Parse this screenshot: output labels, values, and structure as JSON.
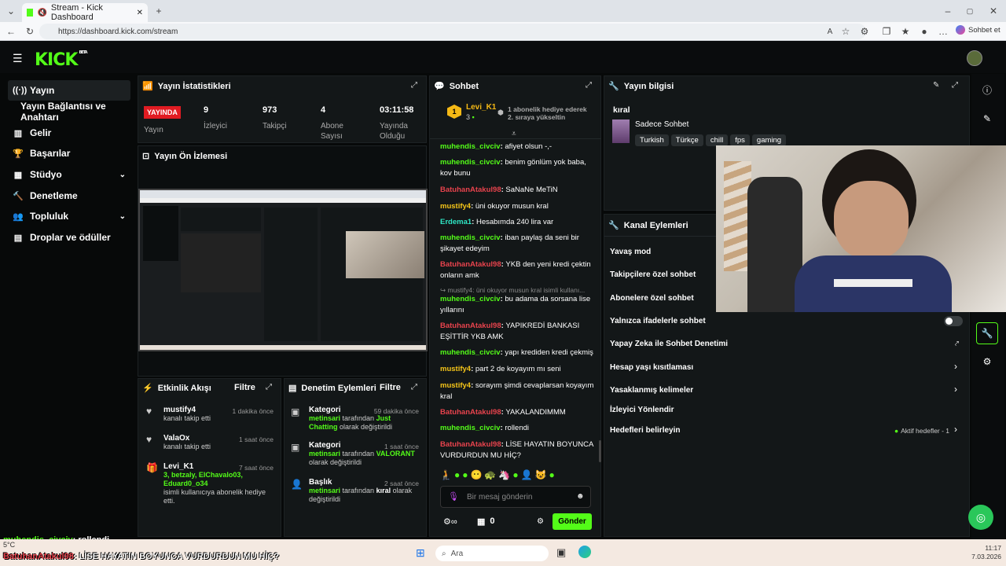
{
  "browser": {
    "tab_title": "Stream - Kick Dashboard",
    "url": "https://dashboard.kick.com/stream",
    "copilot_label": "Sohbet et"
  },
  "brand": {
    "name": "KICK",
    "beta": "BETA",
    "accent": "#53fc18"
  },
  "sidebar": {
    "items": [
      {
        "label": "Yayın",
        "icon": "broadcast-icon"
      },
      {
        "label": "Yayın Bağlantısı ve Anahtarı",
        "icon": ""
      },
      {
        "label": "Gelir",
        "icon": "revenue-icon"
      },
      {
        "label": "Başarılar",
        "icon": "trophy-icon"
      },
      {
        "label": "Stüdyo",
        "icon": "studio-icon"
      },
      {
        "label": "Denetleme",
        "icon": "moderation-icon"
      },
      {
        "label": "Topluluk",
        "icon": "community-icon"
      },
      {
        "label": "Droplar ve ödüller",
        "icon": "drops-icon"
      }
    ]
  },
  "stats": {
    "title": "Yayın İstatistikleri",
    "live_badge": "YAYINDA",
    "live_label": "Yayın",
    "items": [
      {
        "value": "9",
        "label": "İzleyici"
      },
      {
        "value": "973",
        "label": "Takipçi"
      },
      {
        "value": "4",
        "label": "Abone Sayısı"
      },
      {
        "value": "03:11:58",
        "label": "Yayında Olduğu"
      }
    ]
  },
  "preview": {
    "title": "Yayın Ön İzlemesi"
  },
  "activity": {
    "title": "Etkinlik Akışı",
    "filter": "Filtre",
    "items": [
      {
        "name": "mustify4",
        "desc": "kanalı takip etti",
        "time": "1 dakika önce"
      },
      {
        "name": "ValaOx",
        "desc": "kanalı takip etti",
        "time": "1 saat önce"
      },
      {
        "name": "Levi_K1",
        "desc": "isimli kullanıcıya abonelik hediye etti.",
        "time": "7 saat önce",
        "gift": "3, betzaly, ElChavalo03, Eduard0_o34"
      }
    ]
  },
  "mod_actions": {
    "title": "Denetim Eylemleri",
    "filter": "Filtre",
    "items": [
      {
        "title": "Kategori",
        "time": "59 dakika önce",
        "user": "metinsari",
        "mid": " tarafından ",
        "value": "Just Chatting",
        "tail": "olarak değiştirildi"
      },
      {
        "title": "Kategori",
        "time": "1 saat önce",
        "user": "metinsari",
        "mid": " tarafından ",
        "value": "VALORANT",
        "tail": "olarak değiştirildi"
      },
      {
        "title": "Başlık",
        "time": "2 saat önce",
        "user": "metinsari",
        "mid": " tarafından ",
        "value": "kıral",
        "tail": "olarak değiştirildi"
      }
    ]
  },
  "chat": {
    "title": "Sohbet",
    "pinned_user": "Levi_K1",
    "pinned_count": "3",
    "pinned_text1": "1 abonelik hediye ederek",
    "pinned_text2": "2. sıraya yükseltin",
    "messages": [
      {
        "user": "muhendis_civciv",
        "text": "afiyet olsun -,-",
        "color": "green"
      },
      {
        "user": "muhendis_civciv",
        "text": "benim gönlüm yok baba, kov bunu",
        "color": "green"
      },
      {
        "user": "BatuhanAtakul98",
        "text": "SaNaNe MeTiN",
        "color": "red"
      },
      {
        "user": "mustify4",
        "text": "üni okuyor musun kral",
        "color": "yellow"
      },
      {
        "user": "Erdema1",
        "text": "Hesabımda 240 lira var",
        "color": "teal"
      },
      {
        "user": "muhendis_civciv",
        "text": "iban paylaş da seni bir şikayet edeyim",
        "color": "green"
      },
      {
        "user": "BatuhanAtakul98",
        "text": "YKB den yeni kredi çektin onların amk",
        "color": "red"
      },
      {
        "user": "",
        "text": "mustify4: üni okuyor musun kral isimli kullanı...",
        "color": "reply"
      },
      {
        "user": "muhendis_civciv",
        "text": "bu adama da sorsana lise yıllarını",
        "color": "green"
      },
      {
        "user": "BatuhanAtakul98",
        "text": "YAPIKREDİ BANKASI EŞİTTİR YKB AMK",
        "color": "red"
      },
      {
        "user": "muhendis_civciv",
        "text": "yapı krediden kredi çekmiş",
        "color": "green"
      },
      {
        "user": "mustify4",
        "text": "part 2 de koyayım mı seni",
        "color": "yellow"
      },
      {
        "user": "mustify4",
        "text": "sorayım şimdi cevaplarsan koyayım kral",
        "color": "yellow"
      },
      {
        "user": "BatuhanAtakul98",
        "text": "YAKALANDIMMM",
        "color": "red"
      },
      {
        "user": "muhendis_civciv",
        "text": "rollendi",
        "color": "green"
      },
      {
        "user": "BatuhanAtakul98",
        "text": "LİSE HAYATIN BOYUNCA VURDURDUN MU HİÇ?",
        "color": "red"
      }
    ],
    "input_placeholder": "Bir mesaj gönderin",
    "points": "0",
    "send_label": "Gönder"
  },
  "stream_info": {
    "title": "Yayın bilgisi",
    "stream_title": "kıral",
    "category": "Sadece Sohbet",
    "tags": [
      "Turkish",
      "Türkçe",
      "chill",
      "fps",
      "gaming"
    ]
  },
  "channel_actions": {
    "title": "Kanal Eylemleri",
    "items": [
      {
        "label": "Yavaş mod"
      },
      {
        "label": "Takipçilere özel sohbet"
      },
      {
        "label": "Abonelere özel sohbet"
      },
      {
        "label": "Yalnızca ifadelerle sohbet"
      },
      {
        "label": "Yapay Zeka ile Sohbet Denetimi"
      },
      {
        "label": "Hesap yaşı kısıtlaması"
      },
      {
        "label": "Yasaklanmış kelimeler"
      },
      {
        "label": "İzleyici Yönlendir"
      },
      {
        "label": "Hedefleri belirleyin",
        "extra": "Aktif hedefler - 1"
      }
    ]
  },
  "overlay": {
    "line1_user": "muhendis_civciv",
    "line1_text": ": rollendi",
    "line2_user": "BatuhanAtakul98",
    "line2_text": ": LİSE HAYATIN BOYUNCA VURDURDUN MU HİÇ?"
  },
  "taskbar": {
    "weather": "5°C",
    "search_placeholder": "Ara",
    "time": "11:17",
    "date": "7.03.2026"
  }
}
